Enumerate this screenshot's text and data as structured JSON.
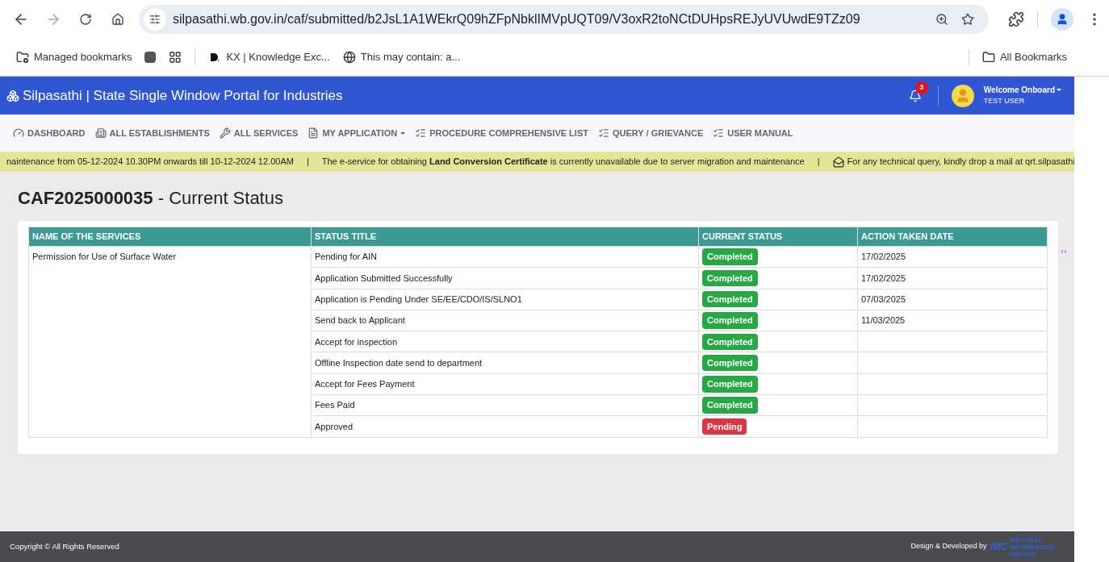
{
  "browser": {
    "url": "silpasathi.wb.gov.in/caf/submitted/b2JsL1A1WEkrQ09hZFpNbklIMVpUQT09/V3oxR2toNCtDUHpsREJyUVUwdE9TZz09",
    "bookmarks": [
      {
        "kind": "folder",
        "label": "Managed bookmarks"
      },
      {
        "kind": "square"
      },
      {
        "kind": "apps"
      },
      {
        "kind": "d",
        "label": "KX | Knowledge Exc..."
      },
      {
        "kind": "globe",
        "label": "This may contain: a..."
      }
    ],
    "all_bookmarks": "All Bookmarks"
  },
  "header": {
    "title": "Silpasathi | State Single Window Portal for Industries",
    "notifications": "3",
    "welcome": "Welcome Onboard",
    "user": "TEST USER"
  },
  "nav": [
    {
      "kind": "gauge",
      "label": "DASHBOARD",
      "dropdown": false
    },
    {
      "kind": "building",
      "label": "ALL ESTABLISHMENTS",
      "dropdown": false
    },
    {
      "kind": "wrench",
      "label": "ALL SERVICES",
      "dropdown": false
    },
    {
      "kind": "doc",
      "label": "MY APPLICATION",
      "dropdown": true
    },
    {
      "kind": "list",
      "label": "PROCEDURE COMPREHENSIVE LIST",
      "dropdown": false
    },
    {
      "kind": "list",
      "label": "QUERY / GRIEVANCE",
      "dropdown": false
    },
    {
      "kind": "list",
      "label": "USER MANUAL",
      "dropdown": false
    }
  ],
  "ticker_separator": "|",
  "ticker": [
    "naintenance from 05-12-2024 10.30PM onwards till 10-12-2024 12.00AM",
    "The e-service for obtaining **Land Conversion Certificate** is currently unavailable due to server migration and maintenance",
    "For any technical query, kindly drop a mail at qrt.silpasathi"
  ],
  "page_title": {
    "id": "CAF2025000035",
    "rest": " - Current Status"
  },
  "table": {
    "columns": [
      "NAME OF THE SERVICES",
      "STATUS TITLE",
      "CURRENT STATUS",
      "ACTION TAKEN DATE"
    ],
    "service": "Permission for Use of Surface Water",
    "rows": [
      {
        "title": "Pending for AIN",
        "status": "Completed",
        "kind": "completed",
        "date": "17/02/2025"
      },
      {
        "title": "Application Submitted Successfully",
        "status": "Completed",
        "kind": "completed",
        "date": "17/02/2025"
      },
      {
        "title": "Application is Pending Under SE/EE/CDO/IS/SLNO1",
        "status": "Completed",
        "kind": "completed",
        "date": "07/03/2025"
      },
      {
        "title": "Send back to Applicant",
        "status": "Completed",
        "kind": "completed",
        "date": "11/03/2025"
      },
      {
        "title": "Accept for inspection",
        "status": "Completed",
        "kind": "completed"
      },
      {
        "title": "Offline Inspection date send to department",
        "status": "Completed",
        "kind": "completed"
      },
      {
        "title": "Accept for Fees Payment",
        "status": "Completed",
        "kind": "completed"
      },
      {
        "title": "Fees Paid",
        "status": "Completed",
        "kind": "completed"
      },
      {
        "title": "Approved",
        "status": "Pending",
        "kind": "pending"
      }
    ]
  },
  "footer": {
    "copyright": "Copyright © All Rights Reserved",
    "developed": "Design & Developed by",
    "logo": "NIC",
    "logo_sub": "NATIONAL INFORMATICS CENTRE"
  }
}
